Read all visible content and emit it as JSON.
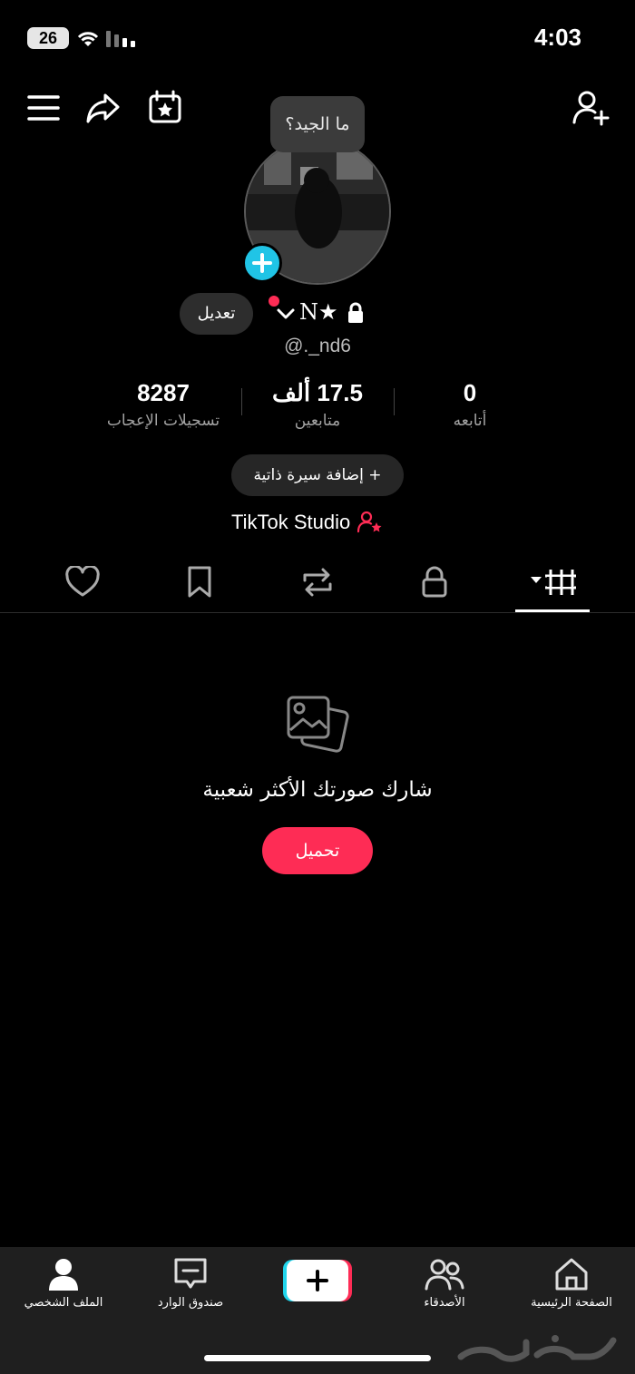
{
  "status_bar": {
    "time": "4:03",
    "battery": "26"
  },
  "tooltip": "ما الجيد؟",
  "profile": {
    "edit_label": "تعديل",
    "display_name": "N★",
    "username": "@._nd6"
  },
  "stats": [
    {
      "value": "8287",
      "label": "تسجيلات الإعجاب"
    },
    {
      "value": "17.5 ألف",
      "label": "متابعين"
    },
    {
      "value": "0",
      "label": "أتابعه"
    }
  ],
  "bio_button": "+ إضافة سيرة ذاتية",
  "studio_link": "TikTok Studio",
  "tabs": [
    "heart-icon",
    "bookmark-icon",
    "repost-icon",
    "lock-icon",
    "grid-icon"
  ],
  "empty_state": {
    "text": "شارك صورتك الأكثر شعبية",
    "button": "تحميل"
  },
  "bottom_nav": {
    "profile": "الملف الشخصي",
    "inbox": "صندوق الوارد",
    "friends": "الأصدقاء",
    "home": "الصفحة الرئيسية"
  },
  "colors": {
    "accent": "#fe2c55",
    "cyan": "#20c4e6",
    "background": "#000000",
    "nav": "#1f1f1f"
  }
}
